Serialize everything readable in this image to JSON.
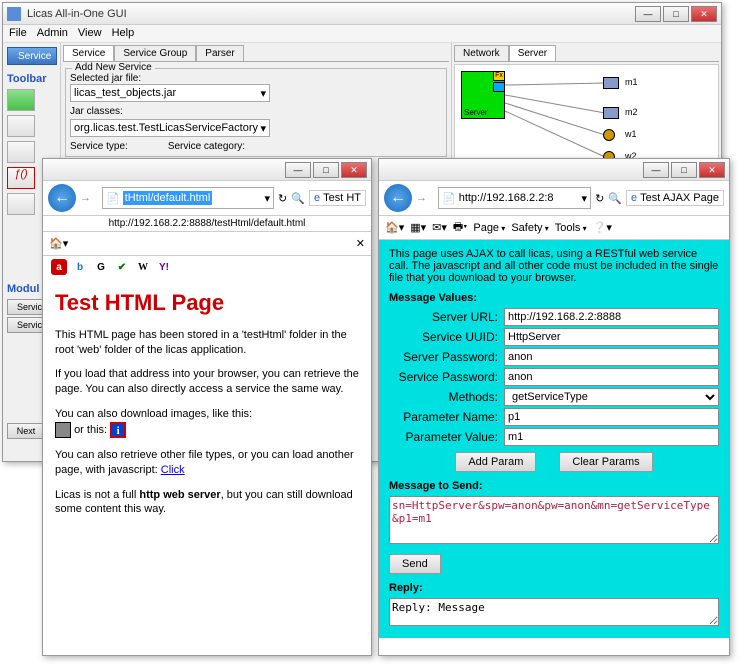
{
  "main": {
    "title": "Licas All-in-One GUI",
    "menu": [
      "File",
      "Admin",
      "View",
      "Help"
    ],
    "serviceBtn": "Service",
    "toolbarLbl": "Toolbar",
    "tabs": [
      "Service",
      "Service Group",
      "Parser"
    ],
    "addService": {
      "legend": "Add New Service",
      "selJar": "Selected jar file:",
      "jarVal": "licas_test_objects.jar",
      "jarClasses": "Jar classes:",
      "classVal": "org.licas.test.TestLicasServiceFactory",
      "svcType": "Service type:",
      "svcCat": "Service category:"
    },
    "netTabs": [
      "Network",
      "Server"
    ],
    "nodes": {
      "server": "Server",
      "m1": "m1",
      "m2": "m2",
      "w1": "w1",
      "w2": "w2"
    },
    "modulLbl": "Modul",
    "serviceRow": "Service",
    "nextBtn": "Next"
  },
  "ie1": {
    "urlSel": "tHtml/default.html",
    "tabTitle": "Test HT",
    "fullUrl": "http://192.168.2.2:8888/testHtml/default.html",
    "h1": "Test HTML Page",
    "p1": "This HTML page has been stored in a 'testHtml' folder in the root 'web' folder of the licas application.",
    "p2": "If you load that address into your browser, you can retrieve the page. You can also directly access a service the same way.",
    "p3a": "You can also download images, like this:",
    "p3b": "or this:",
    "p4a": "You can also retrieve other file types, or you can load another page, with javascript: ",
    "p4link": "Click",
    "p5a": "Licas is not a full ",
    "p5b": "http web server",
    "p5c": ", but you can still download some content this way."
  },
  "ie2": {
    "url": "http://192.168.2.2:8",
    "tabTitle": "Test AJAX Page",
    "toolbar": {
      "page": "Page",
      "safety": "Safety",
      "tools": "Tools"
    },
    "intro": "This page uses AJAX to call licas, using a RESTful web service call. The javascript and all other code must be included in the single file that you download to your browser.",
    "msgVals": "Message Values:",
    "f": {
      "serverUrl": "Server URL:",
      "serverUrlV": "http://192.168.2.2:8888",
      "uuid": "Service UUID:",
      "uuidV": "HttpServer",
      "serverPw": "Server Password:",
      "serverPwV": "anon",
      "servicePw": "Service Password:",
      "servicePwV": "anon",
      "methods": "Methods:",
      "methodsV": "getServiceType",
      "pname": "Parameter Name:",
      "pnameV": "p1",
      "pval": "Parameter Value:",
      "pvalV": "m1"
    },
    "addParam": "Add Param",
    "clearParams": "Clear Params",
    "msgToSend": "Message to Send:",
    "msgBody": "sn=HttpServer&spw=anon&pw=anon&mn=getServiceType&p1=m1",
    "send": "Send",
    "reply": "Reply:",
    "replyBody": "Reply: Message"
  }
}
